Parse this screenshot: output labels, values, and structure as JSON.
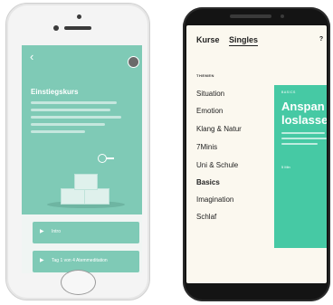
{
  "left_app": {
    "back_glyph": "‹",
    "course_title": "Einstiegskurs",
    "rows": [
      {
        "icon": "play-icon",
        "label": "Intro"
      },
      {
        "icon": "play-icon",
        "label": "Tag 1 von 4 Atemmeditation"
      }
    ]
  },
  "right_app": {
    "tabs": [
      {
        "label": "Kurse",
        "active": false
      },
      {
        "label": "Singles",
        "active": true
      }
    ],
    "info_glyph": "?",
    "section_heading": "THEMEN",
    "topics": [
      {
        "label": "Situation",
        "active": false
      },
      {
        "label": "Emotion",
        "active": false
      },
      {
        "label": "Klang & Natur",
        "active": false
      },
      {
        "label": "7Minis",
        "active": false
      },
      {
        "label": "Uni & Schule",
        "active": false
      },
      {
        "label": "Basics",
        "active": true
      },
      {
        "label": "Imagination",
        "active": false
      },
      {
        "label": "Schlaf",
        "active": false
      }
    ],
    "card": {
      "kicker": "BASICS",
      "title_line1": "Anspan",
      "title_line2": "loslasse",
      "meta": "5 Min"
    }
  },
  "colors": {
    "mint_accent": "#7fcab6",
    "teal_card": "#46c9a4",
    "cream_background": "#fbf8ef"
  }
}
